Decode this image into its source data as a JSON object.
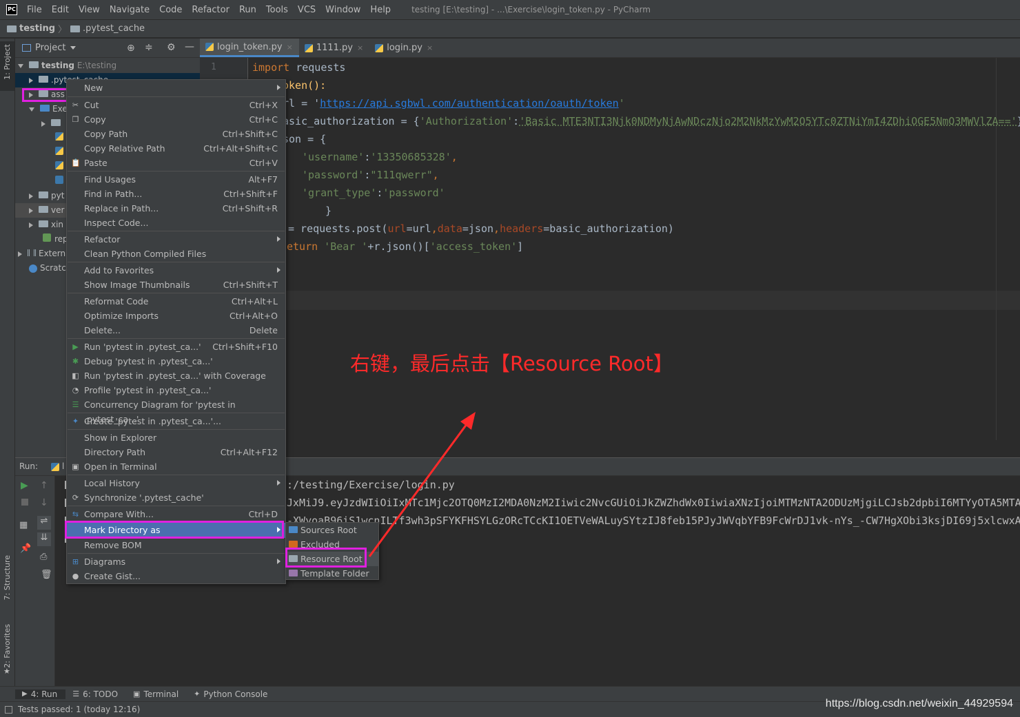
{
  "menubar": {
    "logo": "PC",
    "items": [
      "File",
      "Edit",
      "View",
      "Navigate",
      "Code",
      "Refactor",
      "Run",
      "Tools",
      "VCS",
      "Window",
      "Help"
    ],
    "window_title": "testing [E:\\testing] - ...\\Exercise\\login_token.py - PyCharm"
  },
  "breadcrumb": {
    "root": "testing",
    "child": ".pytest_cache"
  },
  "left_stripe": {
    "project": "1: Project",
    "structure": "7: Structure",
    "favorites": "2: Favorites"
  },
  "project_panel": {
    "title": "Project",
    "tree": [
      {
        "label": "testing",
        "hint": "E:\\testing"
      },
      {
        "label": ".pytest_cache"
      },
      {
        "label": "ass"
      },
      {
        "label": "Exe"
      },
      {
        "label": ""
      },
      {
        "label": ""
      },
      {
        "label": ""
      },
      {
        "label": ""
      },
      {
        "label": ""
      },
      {
        "label": "pyt"
      },
      {
        "label": "ver"
      },
      {
        "label": "xin"
      },
      {
        "label": "rep"
      },
      {
        "label": "Extern"
      },
      {
        "label": "Scratc"
      }
    ]
  },
  "tabs": [
    {
      "label": "login_token.py",
      "close": "×"
    },
    {
      "label": "1111.py",
      "close": "×"
    },
    {
      "label": "login.py",
      "close": "×"
    }
  ],
  "editor": {
    "line_number": "1",
    "code": {
      "l1_kw": "import",
      "l1_rest": " requests",
      "l2": "oken():",
      "l3_a": "rl = '",
      "l3_url": "https://api.sgbwl.com/authentication/oauth/token",
      "l3_b": "'",
      "l4_a": "asic_authorization = {",
      "l4_key": "'Authorization'",
      "l4_colon": ":",
      "l4_val": "'Basic MTE3NTI3Njk0NDMyNjAwNDczNjo2M2NkMzYwM2Q5YTc0ZTNiYmI4ZDhiOGE5NmQ3MWVlZA=='",
      "l4_end": "}",
      "l5": "son = {",
      "l6_key": "'username'",
      "l6_sep": ":",
      "l6_val": "'13350685328'",
      "l6_end": ",",
      "l7_key": "'password'",
      "l7_sep": ":",
      "l7_val": "\"111qwerr\"",
      "l7_end": ",",
      "l8_key": "'grant_type'",
      "l8_sep": ":",
      "l8_val": "'password'",
      "l9": "}",
      "l10_a": "= requests.post(",
      "l10_p1": "url",
      "l10_b": "=url",
      "l10_c": ",",
      "l10_p2": "data",
      "l10_d": "=json",
      "l10_e": ",",
      "l10_p3": "headers",
      "l10_f": "=basic_authorization)",
      "l11_kw": "eturn",
      "l11_s1": " 'Bear '",
      "l11_b": "+r.json()[",
      "l11_s2": "'access_token'",
      "l11_c": "]"
    }
  },
  "run_panel": {
    "label": "Run:",
    "tab_fragment": "l",
    "output": [
      ":/testing/Exercise/login.py",
      "JxMiJ9.eyJzdWIiOiIxMTc1Mjc2OTQ0MzI2MDA0NzM2Iiwic2NvcGUiOiJkZWZhdWx0IiwiaXNzIjoiMTMzNTA2ODUzMjgiLCJsb2dpbiI6MTYyOTA5MTA5",
      "-XWyoaB96iS1wcnILTf3wh3pSFYKFHSYLGzORcTCcKI1OETVeWALuySYtzIJ8feb15PJyJWVqbYFB9FcWrDJ1vk-nYs_-CW7HgXObi3ksjDI69j5xlcwxAT"
    ]
  },
  "context_menu": {
    "items": [
      {
        "label": "New",
        "shortcut": "",
        "submenu": true
      },
      {
        "label": "Cut",
        "shortcut": "Ctrl+X"
      },
      {
        "label": "Copy",
        "shortcut": "Ctrl+C"
      },
      {
        "label": "Copy Path",
        "shortcut": "Ctrl+Shift+C"
      },
      {
        "label": "Copy Relative Path",
        "shortcut": "Ctrl+Alt+Shift+C"
      },
      {
        "label": "Paste",
        "shortcut": "Ctrl+V"
      },
      {
        "label": "Find Usages",
        "shortcut": "Alt+F7"
      },
      {
        "label": "Find in Path...",
        "shortcut": "Ctrl+Shift+F"
      },
      {
        "label": "Replace in Path...",
        "shortcut": "Ctrl+Shift+R"
      },
      {
        "label": "Inspect Code...",
        "shortcut": ""
      },
      {
        "label": "Refactor",
        "shortcut": "",
        "submenu": true
      },
      {
        "label": "Clean Python Compiled Files",
        "shortcut": ""
      },
      {
        "label": "Add to Favorites",
        "shortcut": "",
        "submenu": true
      },
      {
        "label": "Show Image Thumbnails",
        "shortcut": "Ctrl+Shift+T"
      },
      {
        "label": "Reformat Code",
        "shortcut": "Ctrl+Alt+L"
      },
      {
        "label": "Optimize Imports",
        "shortcut": "Ctrl+Alt+O"
      },
      {
        "label": "Delete...",
        "shortcut": "Delete"
      },
      {
        "label": "Run 'pytest in .pytest_ca...'",
        "shortcut": "Ctrl+Shift+F10"
      },
      {
        "label": "Debug 'pytest in .pytest_ca...'",
        "shortcut": ""
      },
      {
        "label": "Run 'pytest in .pytest_ca...' with Coverage",
        "shortcut": ""
      },
      {
        "label": "Profile 'pytest in .pytest_ca...'",
        "shortcut": ""
      },
      {
        "label": "Concurrency Diagram for 'pytest in .pytest_ca...'",
        "shortcut": ""
      },
      {
        "label": "Create 'pytest in .pytest_ca...'...",
        "shortcut": ""
      },
      {
        "label": "Show in Explorer",
        "shortcut": ""
      },
      {
        "label": "Directory Path",
        "shortcut": "Ctrl+Alt+F12"
      },
      {
        "label": "Open in Terminal",
        "shortcut": ""
      },
      {
        "label": "Local History",
        "shortcut": "",
        "submenu": true
      },
      {
        "label": "Synchronize '.pytest_cache'",
        "shortcut": ""
      },
      {
        "label": "Compare With...",
        "shortcut": "Ctrl+D"
      },
      {
        "label": "Mark Directory as",
        "shortcut": "",
        "submenu": true
      },
      {
        "label": "Remove BOM",
        "shortcut": ""
      },
      {
        "label": "Diagrams",
        "shortcut": "",
        "submenu": true
      },
      {
        "label": "Create Gist...",
        "shortcut": ""
      }
    ]
  },
  "mark_submenu": {
    "items": [
      {
        "label": "Sources Root",
        "color": "#4a88c7"
      },
      {
        "label": "Excluded",
        "color": "#d2691e"
      },
      {
        "label": "Resource Root",
        "color": "#9aa7b0"
      },
      {
        "label": "Template Folder",
        "color": "#9876aa"
      }
    ]
  },
  "annotation": "右键，最后点击【Resource Root】",
  "bottom_tabs": [
    {
      "label": "4: Run"
    },
    {
      "label": "6: TODO"
    },
    {
      "label": "Terminal"
    },
    {
      "label": "Python Console"
    }
  ],
  "status": {
    "text": "Tests passed: 1 (today 12:16)"
  },
  "watermark": "https://blog.csdn.net/weixin_44929594",
  "colors": {
    "highlight_box": "#e020e0",
    "annotation_red": "#ff2a2a",
    "selection": "#4b6eaf"
  }
}
